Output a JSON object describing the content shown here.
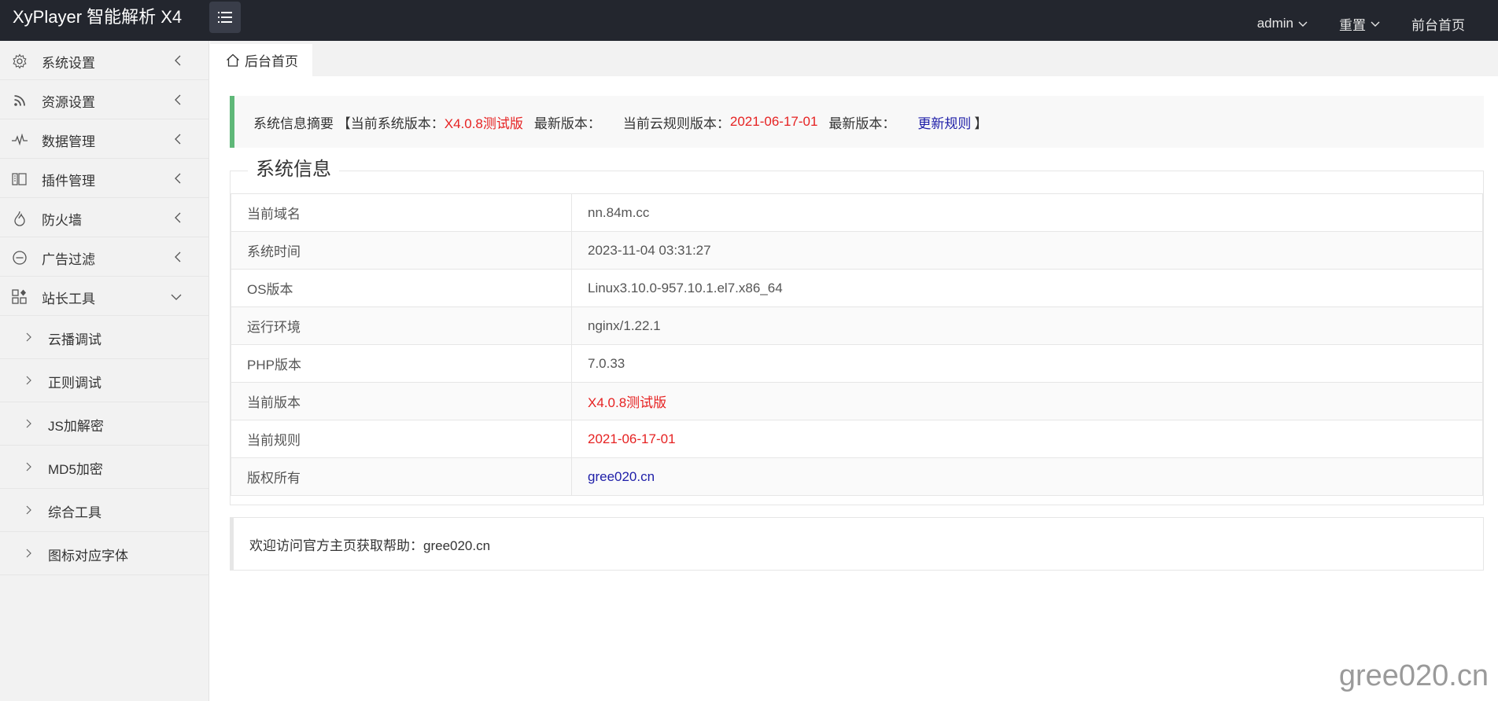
{
  "header": {
    "logo": "XyPlayer 智能解析 X4",
    "nav": [
      {
        "label": "admin",
        "has_dropdown": true
      },
      {
        "label": "重置",
        "has_dropdown": true
      },
      {
        "label": "前台首页",
        "has_dropdown": false
      }
    ]
  },
  "sidebar": {
    "items": [
      {
        "label": "系统设置",
        "icon": "gear-icon"
      },
      {
        "label": "资源设置",
        "icon": "rss-icon"
      },
      {
        "label": "数据管理",
        "icon": "pulse-icon"
      },
      {
        "label": "插件管理",
        "icon": "plugin-icon"
      },
      {
        "label": "防火墙",
        "icon": "fire-icon"
      },
      {
        "label": "广告过滤",
        "icon": "minus-circle-icon"
      },
      {
        "label": "站长工具",
        "icon": "apps-icon",
        "expanded": true
      }
    ],
    "subitems": [
      {
        "label": "云播调试"
      },
      {
        "label": "正则调试"
      },
      {
        "label": "JS加解密"
      },
      {
        "label": "MD5加密"
      },
      {
        "label": "综合工具"
      },
      {
        "label": "图标对应字体"
      }
    ]
  },
  "tabs": [
    {
      "label": "后台首页",
      "icon": "home-icon"
    }
  ],
  "notice": {
    "prefix": "系统信息摘要 【当前系统版本：",
    "current_version": "X4.0.8测试版",
    "latest_label": "最新版本：",
    "rule_label": "当前云规则版本：",
    "rule_version": "2021-06-17-01",
    "latest_rule_label": "最新版本：",
    "update_link": "更新规则",
    "suffix": "】"
  },
  "system_info": {
    "legend": "系统信息",
    "rows": [
      {
        "key": "当前域名",
        "value": "nn.84m.cc",
        "color": "#555555"
      },
      {
        "key": "系统时间",
        "value": "2023-11-04 03:31:27",
        "color": "#555555"
      },
      {
        "key": "OS版本",
        "value": "Linux3.10.0-957.10.1.el7.x86_64",
        "color": "#555555"
      },
      {
        "key": "运行环境",
        "value": "nginx/1.22.1",
        "color": "#555555"
      },
      {
        "key": "PHP版本",
        "value": "7.0.33",
        "color": "#555555"
      },
      {
        "key": "当前版本",
        "value": "X4.0.8测试版",
        "color": "#e62222"
      },
      {
        "key": "当前规则",
        "value": "2021-06-17-01",
        "color": "#e62222"
      },
      {
        "key": "版权所有",
        "value": "gree020.cn",
        "color": "#1e1ea8"
      }
    ]
  },
  "welcome": "欢迎访问官方主页获取帮助：gree020.cn",
  "watermark": "gree020.cn",
  "colors": {
    "header_bg": "#23262e",
    "accent_green": "#5fb878",
    "red": "#e62222",
    "blue": "#1e1ea8"
  }
}
